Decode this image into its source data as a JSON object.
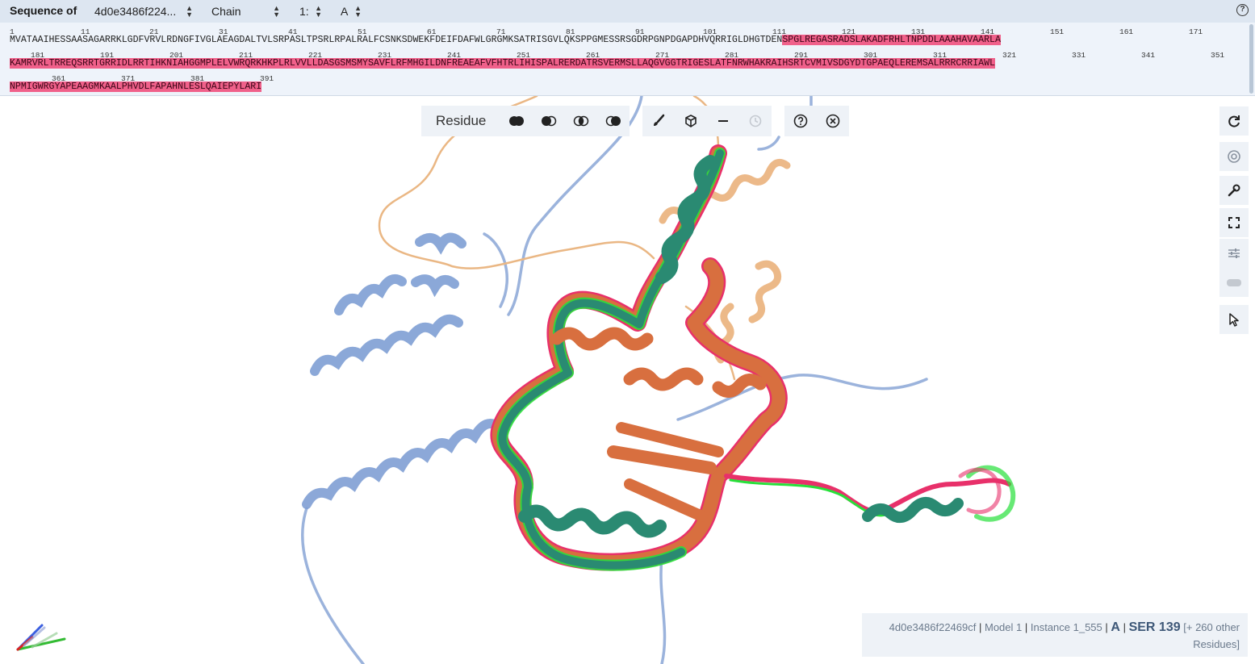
{
  "sequence_panel": {
    "label": "Sequence of",
    "entry_select": "4d0e3486f224...",
    "type_select": "Chain",
    "model_select": "1:",
    "chain_select": "A",
    "help_icon": "?",
    "rows": [
      {
        "numbers": [
          "1",
          "11",
          "21",
          "31",
          "41",
          "51",
          "61",
          "71",
          "81",
          "91",
          "101",
          "111",
          "121",
          "131",
          "141",
          "151",
          "161",
          "171"
        ],
        "plain": "MVATAAIHESSAASAGARRKLGDFVRVLRDNGFIVGLAEAGDALTVLSRPASLTPSRLRPALRALFCSNKSDWEKFDEIFDAFWLGRGMKSATRISGVLQKSPPGMESSRSGDRPGNPDGAPDHVQRRIGLDHGTDEN",
        "highlight": "SPGLREGASRADSLAKADFRHLTNPDDLAAAHAVAARLA"
      },
      {
        "numbers": [
          "181",
          "191",
          "201",
          "211",
          "221",
          "231",
          "241",
          "251",
          "261",
          "271",
          "281",
          "291",
          "301",
          "311",
          "321",
          "331",
          "341",
          "351"
        ],
        "plain": "",
        "highlight": "KAMRVRLTRREQSRRTGRRIDLRRTIHKNIAHGGMPLELVWRQRKHKPLRLVVLLDASGSMSMYSAVFLRFMHGILDNFREAEAFVFHTRLIHISPALRERDATRSVERMSLLAQGVGGTRIGESLATFNRWHAKRAIHSRTCVMIVSDGYDTGPAEQLEREMSALRRRCRRIAWL"
      },
      {
        "numbers": [
          "361",
          "371",
          "381",
          "391"
        ],
        "plain": "",
        "highlight": "NPMIGWRGYAPEAAGMKAALPHVDLFAPAHNLESLQAIEPYLARI"
      }
    ]
  },
  "toolbar": {
    "mode_label": "Residue",
    "icons": [
      "union-icon",
      "subtract-icon",
      "intersect-icon",
      "set-icon",
      "brush-icon",
      "cube-icon",
      "minus-icon",
      "history-icon",
      "help-icon",
      "close-icon"
    ]
  },
  "side_controls": [
    "reset-camera-icon",
    "screenshot-icon",
    "tools-icon",
    "fullscreen-icon",
    "settings-icon",
    "vr-icon",
    "selection-mode-icon"
  ],
  "info": {
    "entry": "4d0e3486f22469cf",
    "model": "Model 1",
    "instance": "Instance 1_555",
    "chain": "A",
    "residue": "SER 139",
    "extra": "[+ 260 other",
    "extra2": "Residues]"
  },
  "colors": {
    "highlight": "#f0608a",
    "chain_blue": "#8aa6d6",
    "chain_orange": "#e7b07a",
    "teal": "#2a8a72",
    "rust": "#d9703f",
    "green_outline": "#22dd33",
    "pink_outline": "#e23060"
  }
}
